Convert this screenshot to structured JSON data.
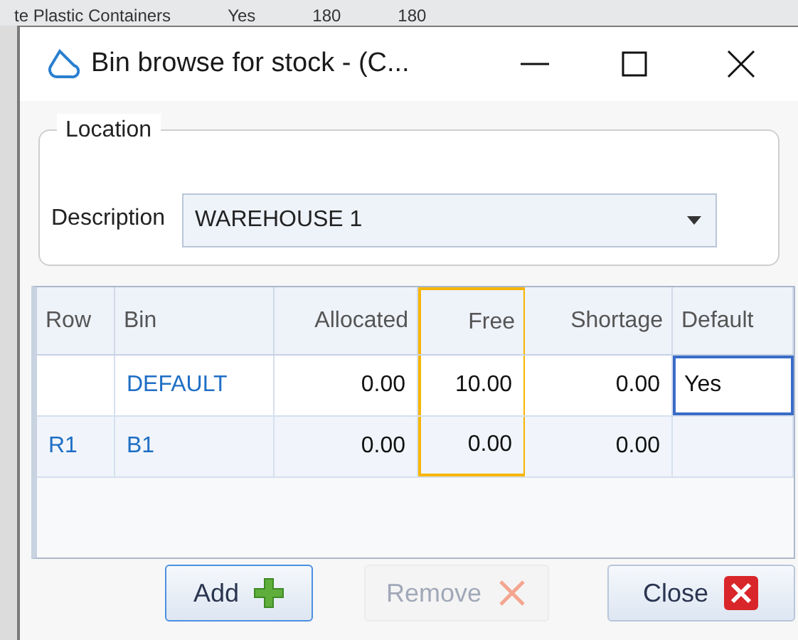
{
  "background_row": {
    "cells": [
      "te Plastic Containers",
      "Yes",
      "180",
      "180"
    ]
  },
  "window": {
    "title": "Bin browse for stock - (C..."
  },
  "location": {
    "legend": "Location",
    "description_label": "Description",
    "description_value": "WAREHOUSE 1"
  },
  "table": {
    "columns": [
      {
        "label": "Row",
        "highlighted": false
      },
      {
        "label": "Bin",
        "highlighted": false
      },
      {
        "label": "Allocated",
        "highlighted": false
      },
      {
        "label": "Free",
        "highlighted": true
      },
      {
        "label": "Shortage",
        "highlighted": false
      },
      {
        "label": "Default",
        "highlighted": false
      }
    ],
    "rows": [
      {
        "cells": [
          {
            "selected": false
          },
          {
            "text": "DEFAULT",
            "selected": false
          },
          {
            "text": "0.00",
            "selected": false
          },
          {
            "text": "10.00",
            "selected": false
          },
          {
            "text": "0.00",
            "selected": false
          },
          {
            "text": "Yes",
            "selected": true
          }
        ]
      },
      {
        "cells": [
          {
            "text": "R1",
            "selected": false
          },
          {
            "text": "B1",
            "selected": false
          },
          {
            "text": "0.00",
            "selected": false
          },
          {
            "text": "0.00",
            "selected": false
          },
          {
            "text": "0.00",
            "selected": false
          },
          {
            "selected": false
          }
        ]
      }
    ]
  },
  "buttons": [
    {
      "label": "Add",
      "kind": "add",
      "disabled": false,
      "focused": true
    },
    {
      "label": "Remove",
      "kind": "remove",
      "disabled": true,
      "focused": false
    },
    {
      "label": "Close",
      "kind": "close",
      "disabled": false,
      "focused": false
    }
  ]
}
